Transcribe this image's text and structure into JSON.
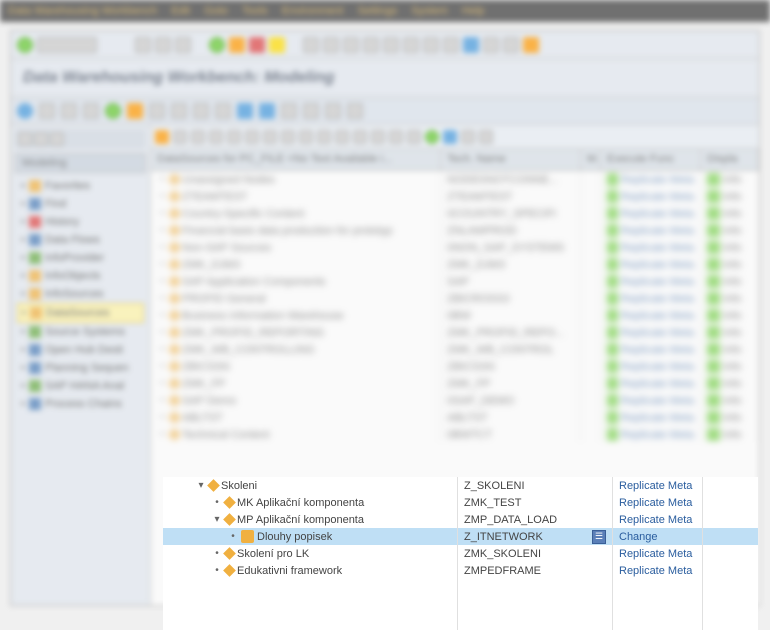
{
  "menubar": [
    "Data Warehousing Workbench",
    "Edit",
    "Goto",
    "Tools",
    "Environment",
    "Settings",
    "System",
    "Help"
  ],
  "page_title": "Data Warehousing Workbench: Modeling",
  "sidebar": {
    "title": "Modeling",
    "items": [
      {
        "label": "Favorites",
        "icon": "star"
      },
      {
        "label": "Find",
        "icon": "find"
      },
      {
        "label": "History",
        "icon": "history"
      },
      {
        "label": "Data Flows",
        "icon": "flow"
      },
      {
        "label": "InfoProvider",
        "icon": "cube"
      },
      {
        "label": "InfoObjects",
        "icon": "obj"
      },
      {
        "label": "InfoSources",
        "icon": "src"
      },
      {
        "label": "DataSources",
        "icon": "ds",
        "active": true
      },
      {
        "label": "Source Systems",
        "icon": "sys"
      },
      {
        "label": "Open Hub Desti",
        "icon": "hub"
      },
      {
        "label": "Planning Sequen",
        "icon": "plan"
      },
      {
        "label": "SAP HANA Anal",
        "icon": "hana"
      },
      {
        "label": "Process Chains",
        "icon": "proc"
      }
    ]
  },
  "columns": [
    "DataSources for PC_FILE <No Text Available i...",
    "Tech. Name",
    "M.",
    "Execute Func",
    "Displa"
  ],
  "blurred_rows": [
    {
      "name": "Unassigned Nodes",
      "tech": "NODESNOTCONNE...",
      "exec": "Replicate Meta",
      "disp": "Info"
    },
    {
      "name": "ZTEAMTEST",
      "tech": "ZTEAMTEST",
      "exec": "Replicate Meta",
      "disp": "Info"
    },
    {
      "name": "Country-Specific Content",
      "tech": "0COUNTRY_SPECIFI",
      "exec": "Replicate Meta",
      "disp": "Info"
    },
    {
      "name": "Financial basis data production for prototyp",
      "tech": "ZNLAWPROD",
      "exec": "Replicate Meta",
      "disp": "Info"
    },
    {
      "name": "Non-SAP Sources",
      "tech": "0NON_SAP_SYSTEMS",
      "exec": "Replicate Meta",
      "disp": "Info"
    },
    {
      "name": "ZMK_DJM3",
      "tech": "ZMK_DJM3",
      "exec": "Replicate Meta",
      "disp": "Info"
    },
    {
      "name": "SAP Application Components",
      "tech": "SAP",
      "exec": "Replicate Meta",
      "disp": "Info"
    },
    {
      "name": "PROFID General",
      "tech": "ZBICROSS3",
      "exec": "Replicate Meta",
      "disp": "Info"
    },
    {
      "name": "Business Information Warehouse",
      "tech": "0BW",
      "exec": "Replicate Meta",
      "disp": "Info"
    },
    {
      "name": "ZMK_PROFID_REPORTING",
      "tech": "ZMK_PROFID_REPO...",
      "exec": "Replicate Meta",
      "disp": "Info"
    },
    {
      "name": "ZMK_WB_CONTROLLING",
      "tech": "ZMK_WB_CONTROL",
      "exec": "Replicate Meta",
      "disp": "Info"
    },
    {
      "name": "ZBICSSN",
      "tech": "ZBICSSN",
      "exec": "Replicate Meta",
      "disp": "Info"
    },
    {
      "name": "ZMK_FP",
      "tech": "ZMK_FP",
      "exec": "Replicate Meta",
      "disp": "Info"
    },
    {
      "name": "SAP Demo",
      "tech": "0SAP_DEMO",
      "exec": "Replicate Meta",
      "disp": "Info"
    },
    {
      "name": "ABLTST",
      "tech": "ABLTST",
      "exec": "Replicate Meta",
      "disp": "Info"
    },
    {
      "name": "Technical Content",
      "tech": "0BWTCT",
      "exec": "Replicate Meta",
      "disp": "Info"
    }
  ],
  "focus_rows": [
    {
      "indent": 1,
      "expand": "v",
      "name": "Skoleni",
      "tech": "Z_SKOLENI",
      "exec": "Replicate Meta",
      "icon": "diamond"
    },
    {
      "indent": 2,
      "expand": "•",
      "name": "MK Aplikační komponenta",
      "tech": "ZMK_TEST",
      "exec": "Replicate Meta",
      "icon": "diamond"
    },
    {
      "indent": 2,
      "expand": "v",
      "name": "MP Aplikační komponenta",
      "tech": "ZMP_DATA_LOAD",
      "exec": "Replicate Meta",
      "icon": "diamond"
    },
    {
      "indent": 3,
      "expand": "•",
      "name": "Dlouhy popisek",
      "tech": "Z_ITNETWORK",
      "exec": "Change",
      "icon": "ds",
      "selected": true
    },
    {
      "indent": 2,
      "expand": "•",
      "name": "Skolení pro LK",
      "tech": "ZMK_SKOLENI",
      "exec": "Replicate Meta",
      "icon": "diamond"
    },
    {
      "indent": 2,
      "expand": "•",
      "name": "Edukativni framework",
      "tech": "ZMPEDFRAME",
      "exec": "Replicate Meta",
      "icon": "diamond"
    }
  ]
}
